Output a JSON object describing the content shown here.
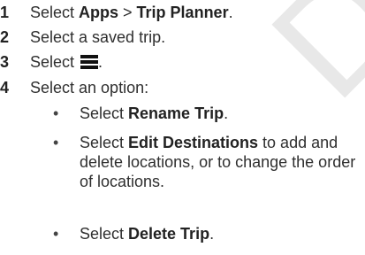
{
  "watermark": "DRAFT",
  "steps": [
    {
      "num": "1",
      "pre": "Select ",
      "b1": "Apps",
      "mid": " > ",
      "b2": "Trip Planner",
      "post": "."
    },
    {
      "num": "2",
      "text": "Select a saved trip."
    },
    {
      "num": "3",
      "pre": "Select ",
      "icon": "menu-icon",
      "post": "."
    },
    {
      "num": "4",
      "text": "Select an option:"
    }
  ],
  "options": [
    {
      "bullet": "•",
      "pre": "Select ",
      "bold": "Rename Trip",
      "post": "."
    },
    {
      "bullet": "•",
      "pre": "Select ",
      "bold": "Edit Destinations",
      "post": " to add and delete locations, or to change the order of locations."
    },
    {
      "bullet": "•",
      "pre": "Select ",
      "bold": "Delete Trip",
      "post": "."
    }
  ]
}
